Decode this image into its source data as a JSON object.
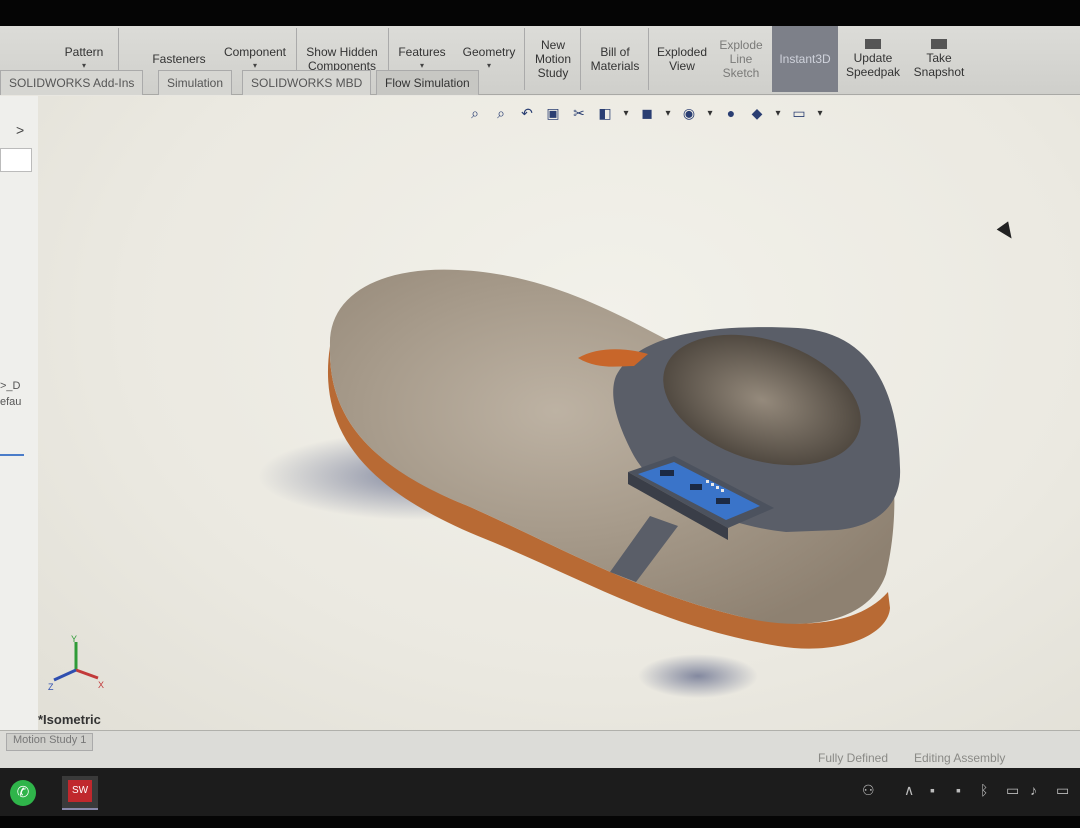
{
  "ribbon": {
    "pattern": "Pattern",
    "fasteners": "Fasteners",
    "component": "Component",
    "show_hidden": "Show Hidden Components",
    "features": "Features",
    "reference_geometry": "Geometry",
    "new_motion_study": "New Motion Study",
    "bill_of_materials": "Bill of Materials",
    "exploded_view": "Exploded View",
    "explode_line_sketch": "Explode Line Sketch",
    "instant3d": "Instant3D",
    "update_speedpak": "Update Speedpak",
    "take_snapshot": "Take Snapshot"
  },
  "tabs": [
    "SOLIDWORKS Add-Ins",
    "Simulation",
    "SOLIDWORKS MBD",
    "Flow Simulation"
  ],
  "active_tab_index": 3,
  "panel": {
    "expand_glyph": ">",
    "item1": ">_D",
    "item2": "efau"
  },
  "viewport": {
    "orientation_label": "*Isometric",
    "triad": {
      "x": "X",
      "y": "Y",
      "z": "Z"
    }
  },
  "bottom": {
    "motion_study_tab": "Motion Study 1",
    "status_left": "Fully Defined",
    "status_right": "Editing Assembly"
  },
  "taskbar": {
    "apps": [
      "whatsapp-icon",
      "solidworks-icon"
    ]
  },
  "colors": {
    "instant3d_bg": "#7d8089",
    "sole": "#b86a34",
    "upper": "#a79c8e",
    "strap": "#5a5e68",
    "board": "#3a74c9"
  }
}
